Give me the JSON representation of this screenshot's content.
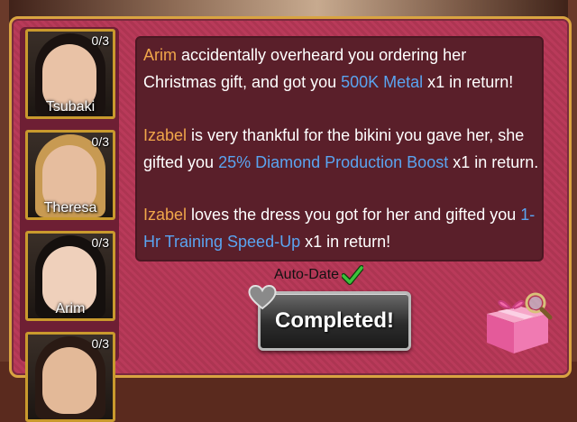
{
  "girls": [
    {
      "name": "Tsubaki",
      "count": "0/3"
    },
    {
      "name": "Theresa",
      "count": "0/3"
    },
    {
      "name": "Arim",
      "count": "0/3"
    },
    {
      "name": "",
      "count": "0/3"
    }
  ],
  "messages": [
    {
      "who": "Arim",
      "a": " accidentally overheard you ordering her Christmas gift, and got you ",
      "item": "500K Metal",
      "b": " x1 in return!"
    },
    {
      "who": "Izabel",
      "a": " is very thankful for the bikini you gave her, she gifted you ",
      "item": "25% Diamond Production Boost",
      "b": " x1 in return."
    },
    {
      "who": "Izabel",
      "a": " loves the dress you got for her and gifted you ",
      "item": "1-Hr Training Speed-Up",
      "b": " x1 in return!"
    }
  ],
  "auto_date": {
    "label": "Auto-Date",
    "checked": true
  },
  "complete_button": {
    "label": "Completed!"
  },
  "icons": {
    "check": "check-icon",
    "heart": "heart-icon",
    "gift": "gift-box-icon",
    "search": "magnifier-icon"
  },
  "colors": {
    "name": "#f0a64a",
    "item": "#5aa4f0",
    "frame": "#d9a441",
    "panel": "#b93a5a"
  }
}
